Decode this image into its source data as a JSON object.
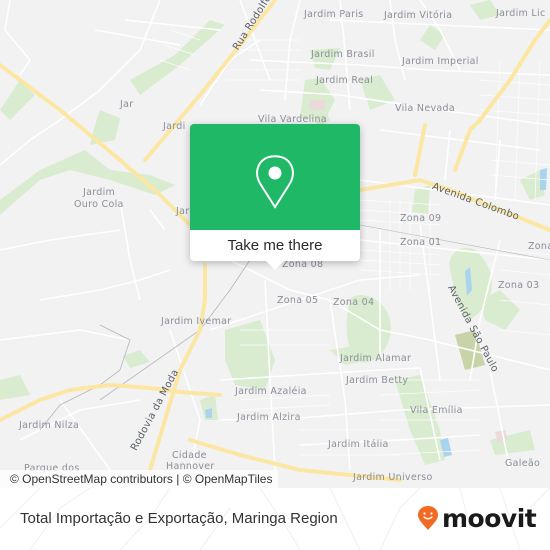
{
  "map": {
    "labels": {
      "rua_rodolfo": "Rua Rodolfo",
      "jardim_paris": "Jardim Paris",
      "jardim_vitoria": "Jardim Vitória",
      "jardim_lic": "Jardim Lic",
      "jardim_brasil": "Jardim Brasil",
      "jardim_imperial": "Jardim Imperial",
      "jardim_real": "Jardim Real",
      "vila_nevada": "Vila Nevada",
      "jar": "Jar",
      "jardi": "Jardi",
      "vila_vardelina": "Vila Vardelina",
      "jardim_ouro_cola_1": "Jardim",
      "jardim_ouro_cola_2": "Ouro Cola",
      "jar2": "Jar",
      "avenida_colombo": "Avenida Colombo",
      "zona_09": "Zona 09",
      "zona_01": "Zona 01",
      "zona_0x": "Zona",
      "zona_03": "Zona 03",
      "zona_05": "Zona 05",
      "zona_04": "Zona 04",
      "zona_08": "Zona 08",
      "avenida_sao_paulo": "Avenida São Paulo",
      "jardim_ivemar": "Jardim Ivemar",
      "jardim_alamar": "Jardim Alamar",
      "jardim_betty": "Jardim Betty",
      "rodovia_da_moda": "Rodovia da Moda",
      "jardim_azaleia": "Jardim Azaléia",
      "jardim_alzira": "Jardim Alzira",
      "vila_emilia": "Vila Emília",
      "jardim_nilza": "Jardim Nilza",
      "jardim_italia": "Jardim Itália",
      "cidade": "Cidade",
      "hannover": "Hannover",
      "parque_dos": "Parque dos",
      "galeao": "Galeão",
      "jardim_universo": "Jardim Universo"
    },
    "attribution": "© OpenStreetMap contributors | © OpenMapTiles",
    "colors": {
      "background": "#f2f2f3",
      "park": "#d9ecd0",
      "water": "#a9d3ef",
      "major_road": "#fbe6a2",
      "minor_road": "#ffffff"
    }
  },
  "popup": {
    "icon": "map-pin-icon",
    "button_label": "Take me there",
    "color": "#1fb866"
  },
  "footer": {
    "title": "Total Importação e Exportação, Maringa Region",
    "logo_text": "moovit",
    "logo_color": "#f26b24"
  }
}
